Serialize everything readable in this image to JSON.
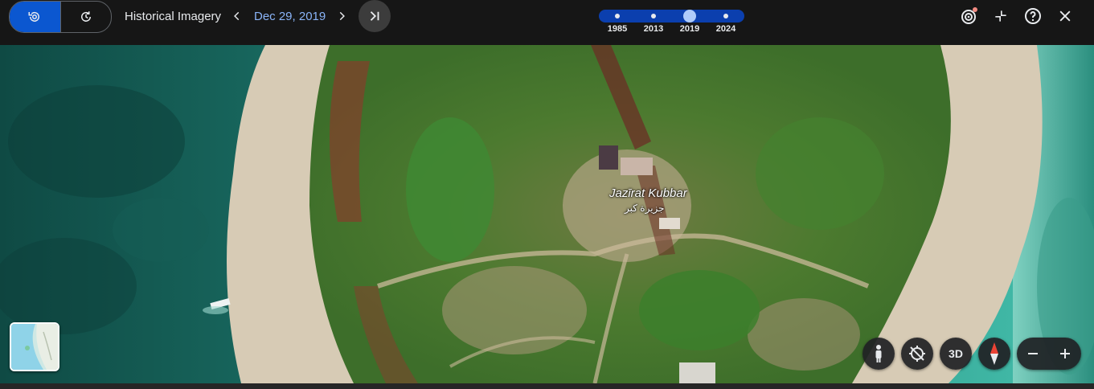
{
  "topbar": {
    "mode_toggle": {
      "items": [
        {
          "icon": "historical-imagery-icon",
          "active": true
        },
        {
          "icon": "history-clock-icon",
          "active": false
        }
      ]
    },
    "section_label": "Historical Imagery",
    "current_date": "Dec 29, 2019",
    "icons": {
      "prev": "chevron-left-icon",
      "next": "chevron-right-icon",
      "latest": "skip-to-latest-icon"
    },
    "timeline": {
      "years": [
        "1985",
        "2013",
        "2019",
        "2024"
      ],
      "selected": "2019"
    },
    "right_icons": [
      "layers-notification-icon",
      "exit-fullscreen-icon",
      "help-icon",
      "close-icon"
    ]
  },
  "map": {
    "place": {
      "name": "Jazīrat Kubbar",
      "name_local": "جزيرة كبر"
    },
    "controls": {
      "pegman_icon": "pegman-icon",
      "tilt_icon": "no-tilt-icon",
      "view_3d_label": "3D",
      "compass_icon": "compass-icon",
      "zoom_out": "−",
      "zoom_in": "+"
    }
  },
  "colors": {
    "accent": "#0b57d0",
    "date_text": "#8ab4f8",
    "timeline_bar": "#0b3fae",
    "topbar_bg": "#161616"
  }
}
